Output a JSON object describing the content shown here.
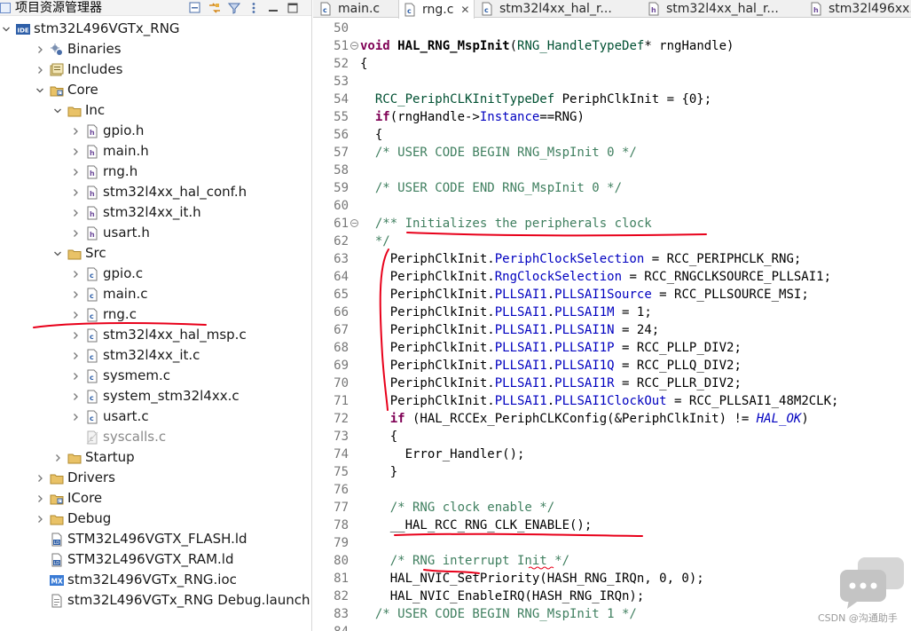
{
  "explorer": {
    "title": "项目资源管理器",
    "items": [
      {
        "label": "stm32L496VGTx_RNG",
        "indent": 0,
        "icon": "ide-project-icon",
        "twisty": "open"
      },
      {
        "label": "Binaries",
        "indent": 1,
        "icon": "binaries-icon",
        "twisty": "closed"
      },
      {
        "label": "Includes",
        "indent": 1,
        "icon": "includes-icon",
        "twisty": "closed"
      },
      {
        "label": "Core",
        "indent": 1,
        "icon": "source-folder-icon",
        "twisty": "open"
      },
      {
        "label": "Inc",
        "indent": 2,
        "icon": "folder-icon",
        "twisty": "open"
      },
      {
        "label": "gpio.h",
        "indent": 3,
        "icon": "header-file-icon",
        "twisty": "closed"
      },
      {
        "label": "main.h",
        "indent": 3,
        "icon": "header-file-icon",
        "twisty": "closed"
      },
      {
        "label": "rng.h",
        "indent": 3,
        "icon": "header-file-icon",
        "twisty": "closed"
      },
      {
        "label": "stm32l4xx_hal_conf.h",
        "indent": 3,
        "icon": "header-file-icon",
        "twisty": "closed"
      },
      {
        "label": "stm32l4xx_it.h",
        "indent": 3,
        "icon": "header-file-icon",
        "twisty": "closed"
      },
      {
        "label": "usart.h",
        "indent": 3,
        "icon": "header-file-icon",
        "twisty": "closed"
      },
      {
        "label": "Src",
        "indent": 2,
        "icon": "folder-icon",
        "twisty": "open"
      },
      {
        "label": "gpio.c",
        "indent": 3,
        "icon": "c-file-icon",
        "twisty": "closed"
      },
      {
        "label": "main.c",
        "indent": 3,
        "icon": "c-file-icon",
        "twisty": "closed"
      },
      {
        "label": "rng.c",
        "indent": 3,
        "icon": "c-file-icon",
        "twisty": "closed"
      },
      {
        "label": "stm32l4xx_hal_msp.c",
        "indent": 3,
        "icon": "c-file-icon",
        "twisty": "closed"
      },
      {
        "label": "stm32l4xx_it.c",
        "indent": 3,
        "icon": "c-file-icon",
        "twisty": "closed"
      },
      {
        "label": "sysmem.c",
        "indent": 3,
        "icon": "c-file-icon",
        "twisty": "closed"
      },
      {
        "label": "system_stm32l4xx.c",
        "indent": 3,
        "icon": "c-file-icon",
        "twisty": "closed"
      },
      {
        "label": "usart.c",
        "indent": 3,
        "icon": "c-file-icon",
        "twisty": "closed"
      },
      {
        "label": "syscalls.c",
        "indent": 3,
        "icon": "c-file-excluded-icon",
        "twisty": "none",
        "grey": true
      },
      {
        "label": "Startup",
        "indent": 2,
        "icon": "folder-icon",
        "twisty": "closed"
      },
      {
        "label": "Drivers",
        "indent": 1,
        "icon": "folder-icon",
        "twisty": "closed"
      },
      {
        "label": "ICore",
        "indent": 1,
        "icon": "source-folder-icon",
        "twisty": "closed"
      },
      {
        "label": "Debug",
        "indent": 1,
        "icon": "folder-icon",
        "twisty": "closed"
      },
      {
        "label": "STM32L496VGTX_FLASH.ld",
        "indent": 1,
        "icon": "ld-file-icon",
        "twisty": "none"
      },
      {
        "label": "STM32L496VGTX_RAM.ld",
        "indent": 1,
        "icon": "ld-file-icon",
        "twisty": "none"
      },
      {
        "label": "stm32L496VGTx_RNG.ioc",
        "indent": 1,
        "icon": "mx-file-icon",
        "twisty": "none"
      },
      {
        "label": "stm32L496VGTx_RNG Debug.launch",
        "indent": 1,
        "icon": "launch-file-icon",
        "twisty": "none"
      }
    ]
  },
  "editor": {
    "tabs": [
      {
        "label": "main.c",
        "icon": "c-file-icon",
        "active": false
      },
      {
        "label": "rng.c",
        "icon": "c-file-icon",
        "active": true,
        "close": "✕"
      },
      {
        "label": "stm32l4xx_hal_r...",
        "icon": "c-file-icon",
        "active": false
      },
      {
        "label": "stm32l4xx_hal_r...",
        "icon": "header-file-icon",
        "active": false
      },
      {
        "label": "stm32l496xx...",
        "icon": "header-file-icon",
        "active": false
      }
    ],
    "lines": [
      {
        "n": "50",
        "fold": false,
        "tokens": []
      },
      {
        "n": "51",
        "fold": true,
        "tokens": [
          [
            "kw",
            "void"
          ],
          [
            "t",
            " "
          ],
          [
            "fn",
            "HAL_RNG_MspInit"
          ],
          [
            "t",
            "("
          ],
          [
            "ty",
            "RNG_HandleTypeDef"
          ],
          [
            "t",
            "* rngHandle)"
          ]
        ]
      },
      {
        "n": "52",
        "fold": false,
        "tokens": [
          [
            "t",
            "{"
          ]
        ]
      },
      {
        "n": "53",
        "fold": false,
        "tokens": []
      },
      {
        "n": "54",
        "fold": false,
        "tokens": [
          [
            "t",
            "  "
          ],
          [
            "ty",
            "RCC_PeriphCLKInitTypeDef"
          ],
          [
            "t",
            " PeriphClkInit = {0};"
          ]
        ]
      },
      {
        "n": "55",
        "fold": false,
        "tokens": [
          [
            "t",
            "  "
          ],
          [
            "kw",
            "if"
          ],
          [
            "t",
            "(rngHandle->"
          ],
          [
            "fld",
            "Instance"
          ],
          [
            "t",
            "==RNG)"
          ]
        ]
      },
      {
        "n": "56",
        "fold": false,
        "tokens": [
          [
            "t",
            "  {"
          ]
        ]
      },
      {
        "n": "57",
        "fold": false,
        "tokens": [
          [
            "t",
            "  "
          ],
          [
            "cm",
            "/* USER CODE BEGIN RNG_MspInit 0 */"
          ]
        ]
      },
      {
        "n": "58",
        "fold": false,
        "tokens": []
      },
      {
        "n": "59",
        "fold": false,
        "tokens": [
          [
            "t",
            "  "
          ],
          [
            "cm",
            "/* USER CODE END RNG_MspInit 0 */"
          ]
        ]
      },
      {
        "n": "60",
        "fold": false,
        "tokens": []
      },
      {
        "n": "61",
        "fold": true,
        "tokens": [
          [
            "t",
            "  "
          ],
          [
            "cm",
            "/** Initializes the peripherals clock"
          ]
        ]
      },
      {
        "n": "62",
        "fold": false,
        "tokens": [
          [
            "t",
            "  "
          ],
          [
            "cm",
            "*/"
          ]
        ]
      },
      {
        "n": "63",
        "fold": false,
        "tokens": [
          [
            "t",
            "    PeriphClkInit."
          ],
          [
            "fld",
            "PeriphClockSelection"
          ],
          [
            "t",
            " = RCC_PERIPHCLK_RNG;"
          ]
        ]
      },
      {
        "n": "64",
        "fold": false,
        "tokens": [
          [
            "t",
            "    PeriphClkInit."
          ],
          [
            "fld",
            "RngClockSelection"
          ],
          [
            "t",
            " = RCC_RNGCLKSOURCE_PLLSAI1;"
          ]
        ]
      },
      {
        "n": "65",
        "fold": false,
        "tokens": [
          [
            "t",
            "    PeriphClkInit."
          ],
          [
            "fld",
            "PLLSAI1"
          ],
          [
            "t",
            "."
          ],
          [
            "fld",
            "PLLSAI1Source"
          ],
          [
            "t",
            " = RCC_PLLSOURCE_MSI;"
          ]
        ]
      },
      {
        "n": "66",
        "fold": false,
        "tokens": [
          [
            "t",
            "    PeriphClkInit."
          ],
          [
            "fld",
            "PLLSAI1"
          ],
          [
            "t",
            "."
          ],
          [
            "fld",
            "PLLSAI1M"
          ],
          [
            "t",
            " = 1;"
          ]
        ]
      },
      {
        "n": "67",
        "fold": false,
        "tokens": [
          [
            "t",
            "    PeriphClkInit."
          ],
          [
            "fld",
            "PLLSAI1"
          ],
          [
            "t",
            "."
          ],
          [
            "fld",
            "PLLSAI1N"
          ],
          [
            "t",
            " = 24;"
          ]
        ]
      },
      {
        "n": "68",
        "fold": false,
        "tokens": [
          [
            "t",
            "    PeriphClkInit."
          ],
          [
            "fld",
            "PLLSAI1"
          ],
          [
            "t",
            "."
          ],
          [
            "fld",
            "PLLSAI1P"
          ],
          [
            "t",
            " = RCC_PLLP_DIV2;"
          ]
        ]
      },
      {
        "n": "69",
        "fold": false,
        "tokens": [
          [
            "t",
            "    PeriphClkInit."
          ],
          [
            "fld",
            "PLLSAI1"
          ],
          [
            "t",
            "."
          ],
          [
            "fld",
            "PLLSAI1Q"
          ],
          [
            "t",
            " = RCC_PLLQ_DIV2;"
          ]
        ]
      },
      {
        "n": "70",
        "fold": false,
        "tokens": [
          [
            "t",
            "    PeriphClkInit."
          ],
          [
            "fld",
            "PLLSAI1"
          ],
          [
            "t",
            "."
          ],
          [
            "fld",
            "PLLSAI1R"
          ],
          [
            "t",
            " = RCC_PLLR_DIV2;"
          ]
        ]
      },
      {
        "n": "71",
        "fold": false,
        "tokens": [
          [
            "t",
            "    PeriphClkInit."
          ],
          [
            "fld",
            "PLLSAI1"
          ],
          [
            "t",
            "."
          ],
          [
            "fld",
            "PLLSAI1ClockOut"
          ],
          [
            "t",
            " = RCC_PLLSAI1_48M2CLK;"
          ]
        ]
      },
      {
        "n": "72",
        "fold": false,
        "tokens": [
          [
            "t",
            "    "
          ],
          [
            "kw",
            "if"
          ],
          [
            "t",
            " (HAL_RCCEx_PeriphCLKConfig(&PeriphClkInit) != "
          ],
          [
            "it",
            "HAL_OK"
          ],
          [
            "t",
            ")"
          ]
        ]
      },
      {
        "n": "73",
        "fold": false,
        "tokens": [
          [
            "t",
            "    {"
          ]
        ]
      },
      {
        "n": "74",
        "fold": false,
        "tokens": [
          [
            "t",
            "      Error_Handler();"
          ]
        ]
      },
      {
        "n": "75",
        "fold": false,
        "tokens": [
          [
            "t",
            "    }"
          ]
        ]
      },
      {
        "n": "76",
        "fold": false,
        "tokens": []
      },
      {
        "n": "77",
        "fold": false,
        "tokens": [
          [
            "t",
            "    "
          ],
          [
            "cm",
            "/* RNG clock enable */"
          ]
        ]
      },
      {
        "n": "78",
        "fold": false,
        "tokens": [
          [
            "t",
            "    __HAL_RCC_RNG_CLK_ENABLE();"
          ]
        ]
      },
      {
        "n": "79",
        "fold": false,
        "tokens": []
      },
      {
        "n": "80",
        "fold": false,
        "tokens": [
          [
            "t",
            "    "
          ],
          [
            "cm",
            "/* RNG interrupt Init */"
          ]
        ]
      },
      {
        "n": "81",
        "fold": false,
        "tokens": [
          [
            "t",
            "    HAL_NVIC_SetPriority(HASH_RNG_IRQn, 0, 0);"
          ]
        ]
      },
      {
        "n": "82",
        "fold": false,
        "tokens": [
          [
            "t",
            "    HAL_NVIC_EnableIRQ(HASH_RNG_IRQn);"
          ]
        ]
      },
      {
        "n": "83",
        "fold": false,
        "tokens": [
          [
            "t",
            "  "
          ],
          [
            "cm",
            "/* USER CODE BEGIN RNG_MspInit 1 */"
          ]
        ]
      },
      {
        "n": "84",
        "fold": false,
        "tokens": []
      }
    ]
  },
  "watermark": "CSDN @沟通助手",
  "colors": {
    "annotation": "#e8001a",
    "keyword": "#7f0055",
    "comment": "#3f7f5f",
    "field": "#0000c0",
    "type": "#005032"
  }
}
